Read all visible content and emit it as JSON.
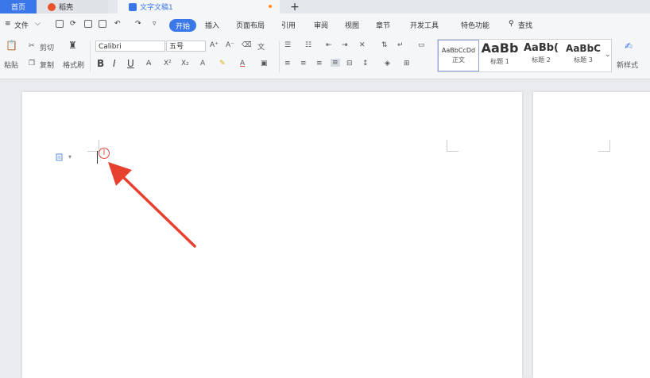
{
  "tabs": {
    "home": "首页",
    "daoke": "稻壳",
    "doc": "文字文稿1",
    "new_tab": "+"
  },
  "menu": {
    "file": "文件",
    "items": [
      "开始",
      "插入",
      "页面布局",
      "引用",
      "审阅",
      "视图",
      "章节",
      "开发工具",
      "特色功能"
    ],
    "search": "查找"
  },
  "ribbon": {
    "paste": "粘贴",
    "cut": "剪切",
    "copy": "复制",
    "format_painter": "格式刷",
    "font_name": "Calibri",
    "font_size": "五号",
    "bold": "B",
    "italic": "I",
    "underline": "U",
    "styles": [
      {
        "sample": "AaBbCcDd",
        "label": "正文"
      },
      {
        "sample": "AaBb",
        "label": "标题 1"
      },
      {
        "sample": "AaBb(",
        "label": "标题 2"
      },
      {
        "sample": "AaBbC",
        "label": "标题 3"
      }
    ],
    "new_style": "新样式"
  },
  "colors": {
    "accent": "#3a77e8",
    "arrow": "#e8402f"
  }
}
